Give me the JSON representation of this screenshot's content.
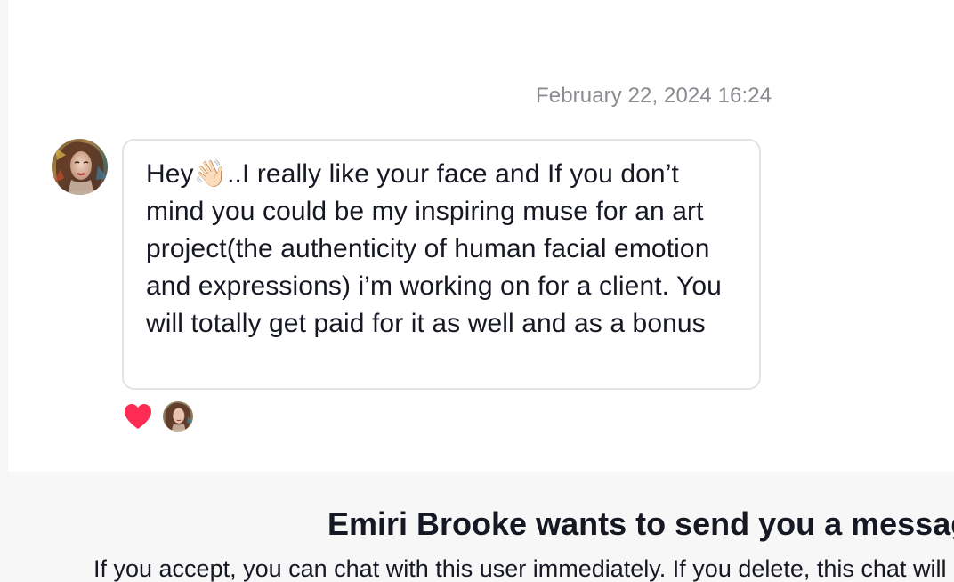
{
  "conversation": {
    "timestamp": "February 22, 2024 16:24",
    "message": {
      "text": "Hey👋🏻..I really like your face and If you don’t mind you could be my inspiring muse for an art project(the authenticity of human facial emotion and expressions) i’m working on for a client. You will totally get paid for it as well and as a bonus",
      "reaction": "heart-icon"
    }
  },
  "message_request": {
    "title": "Emiri Brooke wants to send you a message",
    "description": "If you accept, you can chat with this user immediately. If you delete, this chat will be removed."
  },
  "colors": {
    "text_primary": "#161823",
    "text_muted": "#8a8b91",
    "bubble_border": "#e3e3e4",
    "panel_background": "#f7f7f8",
    "heart": "#fe2c55"
  }
}
